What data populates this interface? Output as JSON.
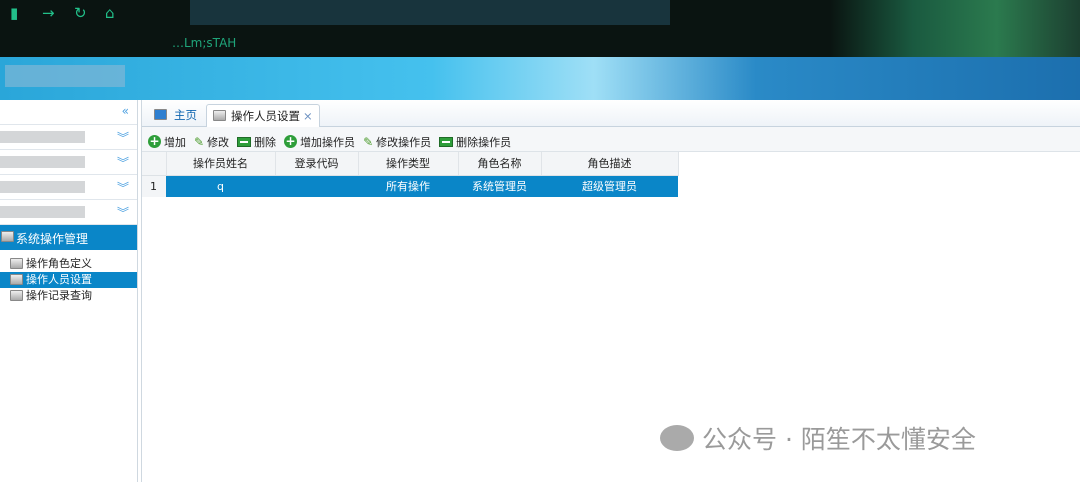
{
  "browser": {
    "brand": "…Lm;sTAH",
    "icons": [
      "back-icon",
      "forward-icon",
      "refresh-icon",
      "home-icon"
    ]
  },
  "sidebar": {
    "collapse": "«",
    "group": "系统操作管理",
    "items": [
      {
        "label": "操作角色定义"
      },
      {
        "label": "操作人员设置",
        "selected": true
      },
      {
        "label": "操作记录查询"
      }
    ]
  },
  "tabs": [
    {
      "label": "主页"
    },
    {
      "label": "操作人员设置",
      "close": "×"
    }
  ],
  "toolbar": [
    "增加",
    "修改",
    "删除",
    "增加操作员",
    "修改操作员",
    "删除操作员"
  ],
  "table": {
    "columns": [
      "操作员姓名",
      "登录代码",
      "操作类型",
      "角色名称",
      "角色描述"
    ],
    "rows": [
      {
        "num": "1",
        "cells": [
          "q",
          "",
          "所有操作",
          "系统管理员",
          "超级管理员"
        ]
      }
    ]
  },
  "watermark": "公众号 · 陌笙不太懂安全",
  "colors": {
    "accent": "#0a86c8",
    "toolbar_green": "#2e9e3a"
  }
}
